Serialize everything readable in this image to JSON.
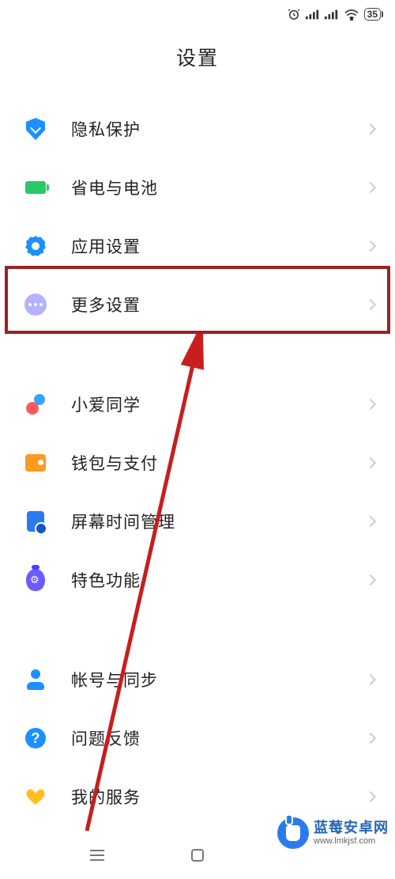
{
  "status_bar": {
    "battery_percent": "35"
  },
  "page": {
    "title": "设置"
  },
  "groups": [
    {
      "items": [
        {
          "key": "privacy",
          "label": "隐私保护"
        },
        {
          "key": "battery",
          "label": "省电与电池"
        },
        {
          "key": "apps",
          "label": "应用设置"
        },
        {
          "key": "more",
          "label": "更多设置"
        }
      ]
    },
    {
      "items": [
        {
          "key": "xiaoai",
          "label": "小爱同学"
        },
        {
          "key": "wallet",
          "label": "钱包与支付"
        },
        {
          "key": "screentime",
          "label": "屏幕时间管理"
        },
        {
          "key": "special",
          "label": "特色功能"
        }
      ]
    },
    {
      "items": [
        {
          "key": "account",
          "label": "帐号与同步"
        },
        {
          "key": "feedback",
          "label": "问题反馈"
        },
        {
          "key": "services",
          "label": "我的服务"
        }
      ]
    }
  ],
  "annotation": {
    "highlighted_item": "more"
  },
  "watermark": {
    "title": "蓝莓安卓网",
    "url": "www.lmkjsf.com"
  }
}
